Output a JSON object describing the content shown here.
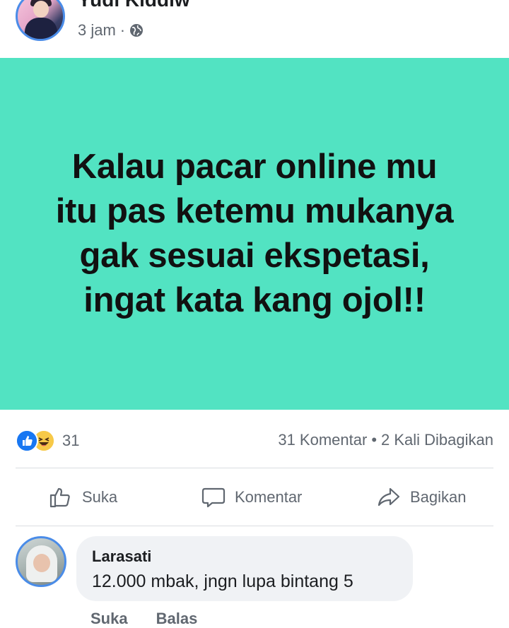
{
  "post": {
    "author": "Yudi Kiddiw",
    "time": "3 jam",
    "separator": "·",
    "privacy_icon": "globe-icon"
  },
  "banner": {
    "text": "Kalau pacar online mu\nitu pas ketemu mukanya\ngak sesuai ekspetasi,\ningat kata kang ojol!!",
    "background": "#52e3c2"
  },
  "stats": {
    "reactions": [
      "like-icon",
      "haha-icon"
    ],
    "reaction_count": "31",
    "comments": "31 Komentar",
    "separator": "•",
    "shares": "2 Kali Dibagikan"
  },
  "actions": {
    "like": "Suka",
    "comment": "Komentar",
    "share": "Bagikan"
  },
  "comment": {
    "author": "Larasati",
    "text": "12.000 mbak, jngn lupa bintang 5",
    "like": "Suka",
    "reply": "Balas"
  },
  "colors": {
    "accent": "#1877f2",
    "avatar_ring": "#4a8ce8",
    "muted_text": "#606770",
    "bubble_bg": "#f0f2f5"
  }
}
